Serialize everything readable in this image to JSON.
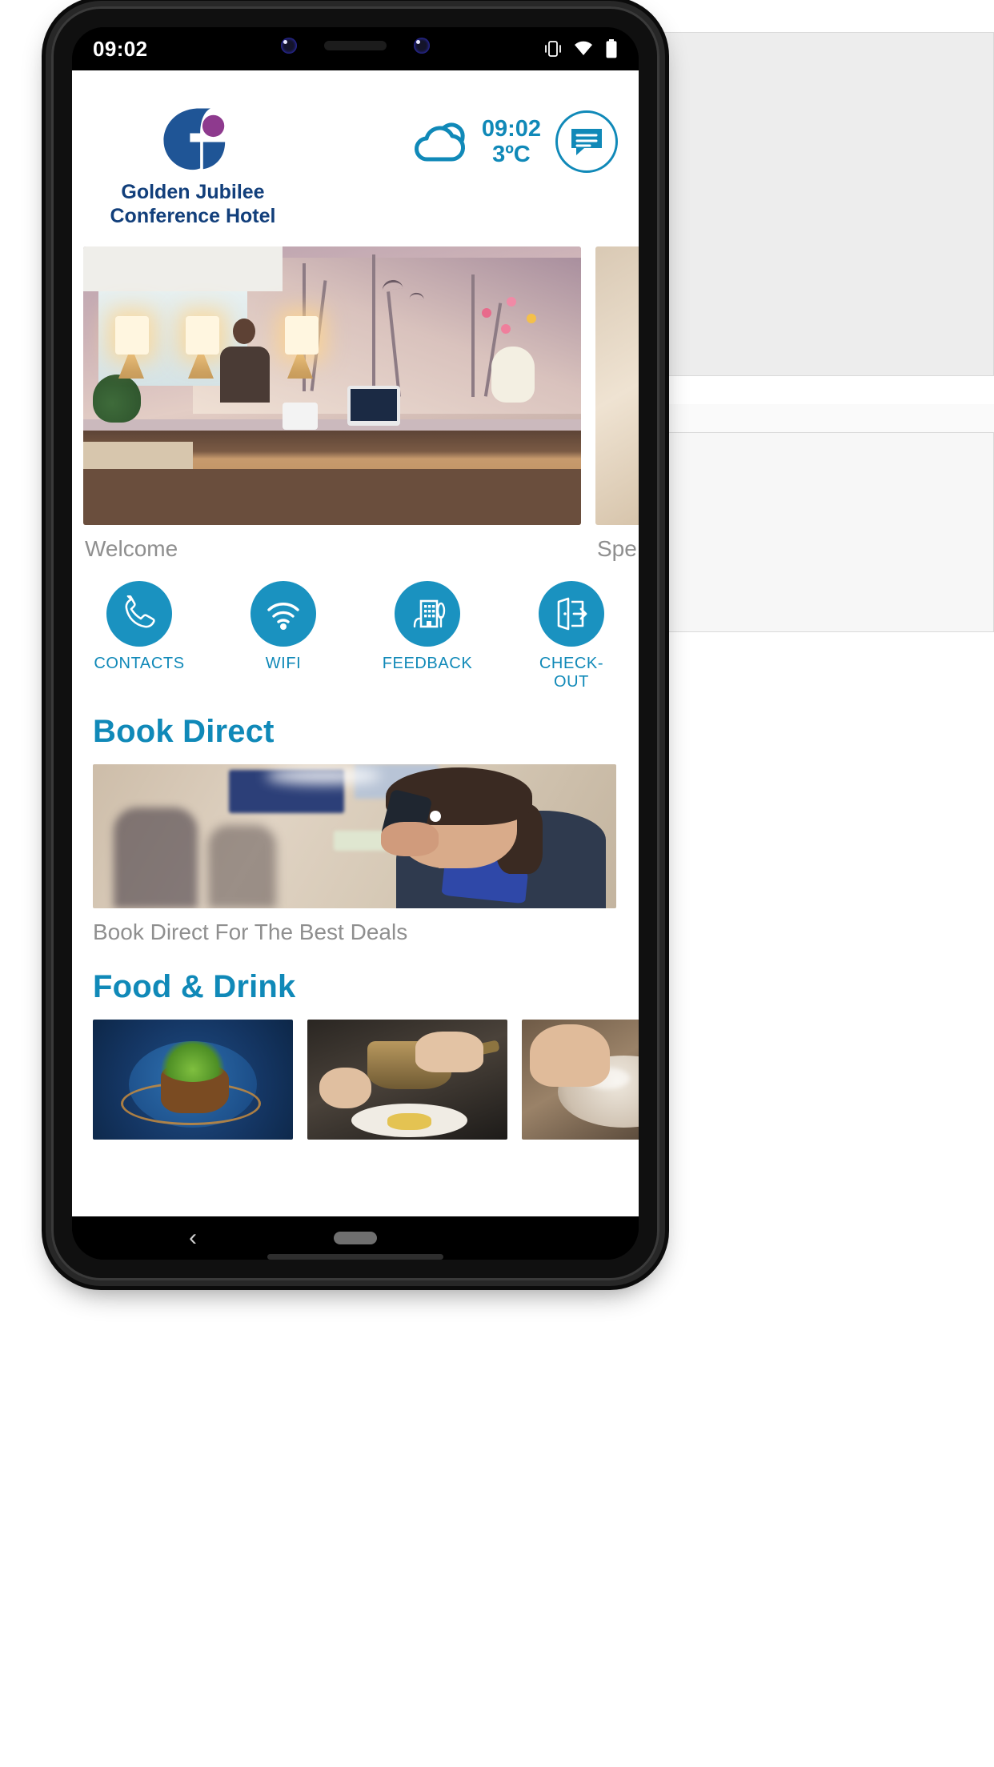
{
  "status_bar": {
    "time": "09:02",
    "icons": [
      "vibrate-icon",
      "wifi-icon",
      "battery-icon"
    ]
  },
  "header": {
    "logo_icon": "golden-jubilee-logo",
    "brand_name": "Golden Jubilee\nConference Hotel",
    "weather": {
      "icon": "cloud-icon",
      "time": "09:02",
      "temperature": "3ºC"
    },
    "chat_icon": "chat-bubble-icon"
  },
  "carousel": {
    "slides": [
      {
        "image": "hotel-reception-photo",
        "caption": "Welcome"
      },
      {
        "image": "special-offer-photo",
        "caption": "Spe"
      }
    ]
  },
  "quick_actions": [
    {
      "icon": "phone-icon",
      "label": "CONTACTS"
    },
    {
      "icon": "wifi-icon",
      "label": "WIFI"
    },
    {
      "icon": "building-feedback-icon",
      "label": "FEEDBACK"
    },
    {
      "icon": "door-exit-icon",
      "label": "CHECK-OUT"
    }
  ],
  "sections": [
    {
      "title": "Book Direct",
      "image": "receptionist-on-phone-photo",
      "caption": "Book Direct For The Best Deals"
    },
    {
      "title": "Food & Drink",
      "cards": [
        {
          "image": "plated-dish-photo"
        },
        {
          "image": "chef-pouring-sauce-photo"
        },
        {
          "image": "chef-plating-photo"
        }
      ]
    }
  ],
  "nav_bar": {
    "back_icon": "chevron-left-icon",
    "home_pill": "home-pill-indicator"
  },
  "colors": {
    "accent": "#1089b8",
    "brand_navy": "#123f7b",
    "brand_purple": "#8e3a8e",
    "caption_grey": "#8f8f8f"
  }
}
